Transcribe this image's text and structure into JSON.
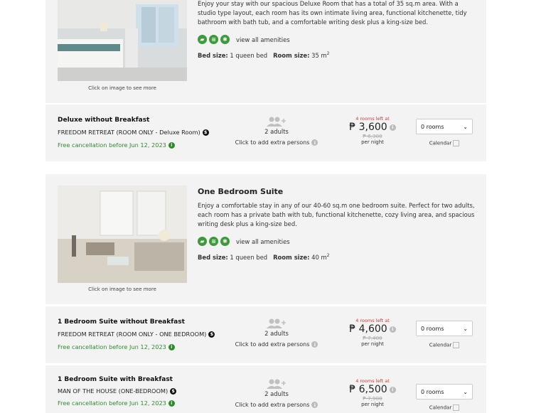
{
  "rooms": {
    "deluxe": {
      "description": "Enjoy your stay with our spacious Deluxe Room that has a total of 35 sq.m area. With a studio type layout, each room has its own intimate living area, functional kitchenette, tidy bathroom with bath tub, and a comfortable writing desk plus a king-size bed.",
      "view_amenities": "view all amenities",
      "bed_size_label": "Bed size:",
      "bed_size": "1 queen bed",
      "room_size_label": "Room size:",
      "room_size": "35 m",
      "room_size_unit_sup": "2",
      "caption": "Click on image to see more"
    },
    "suite": {
      "title": "One Bedroom Suite",
      "description": "Enjoy a comfortable stay in any of our 40-60 sq.m one bedroom suite. Perfect for two adults, each room has a private bath with tub, functional kitchenette, cozy living area, and spacious writing desk plus a king-size bed.",
      "view_amenities": "view all amenities",
      "bed_size_label": "Bed size:",
      "bed_size": "1 queen bed",
      "room_size_label": "Room size:",
      "room_size": "40 m",
      "room_size_unit_sup": "2",
      "caption": "Click on image to see more"
    }
  },
  "rates": [
    {
      "name": "Deluxe without Breakfast",
      "plan": "FREEDOM RETREAT (ROOM ONLY - Deluxe Room)",
      "cancel": "Free cancellation before Jun 12, 2023",
      "guests": "2 adults",
      "add_persons": "Click to add extra persons",
      "rooms_left": "4 rooms left at",
      "price": "₱ 3,600",
      "old_price": "₱ 6,300",
      "per_night": "per night",
      "rooms_select": "0 rooms",
      "calendar": "Calendar"
    },
    {
      "name": "1 Bedroom Suite without Breakfast",
      "plan": "FREEDOM RETREAT (ROOM ONLY - ONE BEDROOM)",
      "cancel": "Free cancellation before Jun 12, 2023",
      "guests": "2 adults",
      "add_persons": "Click to add extra persons",
      "rooms_left": "4 rooms left at",
      "price": "₱ 4,600",
      "old_price": "₱ 7,400",
      "per_night": "per night",
      "rooms_select": "0 rooms",
      "calendar": "Calendar"
    },
    {
      "name": "1 Bedroom Suite with Breakfast",
      "plan": "MAN OF THE HOUSE (ONE-BEDROOM)",
      "cancel": "Free cancellation before Jun 12, 2023",
      "guests": "2 adults",
      "add_persons": "Click to add extra persons",
      "rooms_left": "4 rooms left at",
      "price": "₱ 6,500",
      "old_price": "₱ 7,900",
      "per_night": "per night",
      "rooms_select": "0 rooms",
      "calendar": "Calendar"
    }
  ],
  "colors": {
    "amenity_icon": "#3c9a3a",
    "cancel_text": "#2e8b2e",
    "rooms_left_text": "#dd3333",
    "card_bg": "#f3f3f3"
  },
  "icons": [
    "kitchen-icon",
    "wifi-icon",
    "aircon-icon",
    "dollar-icon",
    "info-icon",
    "people-add-icon",
    "calendar-icon",
    "chevron-down-icon"
  ]
}
